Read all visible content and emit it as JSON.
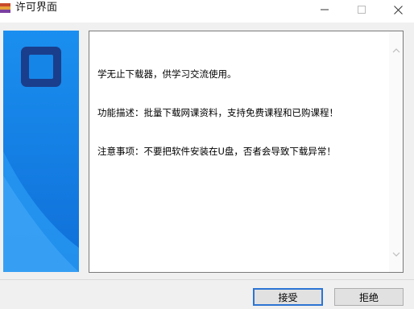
{
  "window": {
    "title": "许可界面",
    "minimize_icon": "minimize-icon",
    "maximize_icon": "maximize-icon",
    "close_icon": "close-icon"
  },
  "license": {
    "lines": [
      "学无止下载器，供学习交流使用。",
      "功能描述：批量下载网课资料，支持免费课程和已购课程！",
      "注意事项：不要把软件安装在U盘，否者会导致下载异常！"
    ]
  },
  "buttons": {
    "accept": "接受",
    "reject": "拒绝"
  },
  "colors": {
    "banner_blue": "#1585e8",
    "logo_blue": "#1a3e8c",
    "accent": "#2c74d4"
  }
}
